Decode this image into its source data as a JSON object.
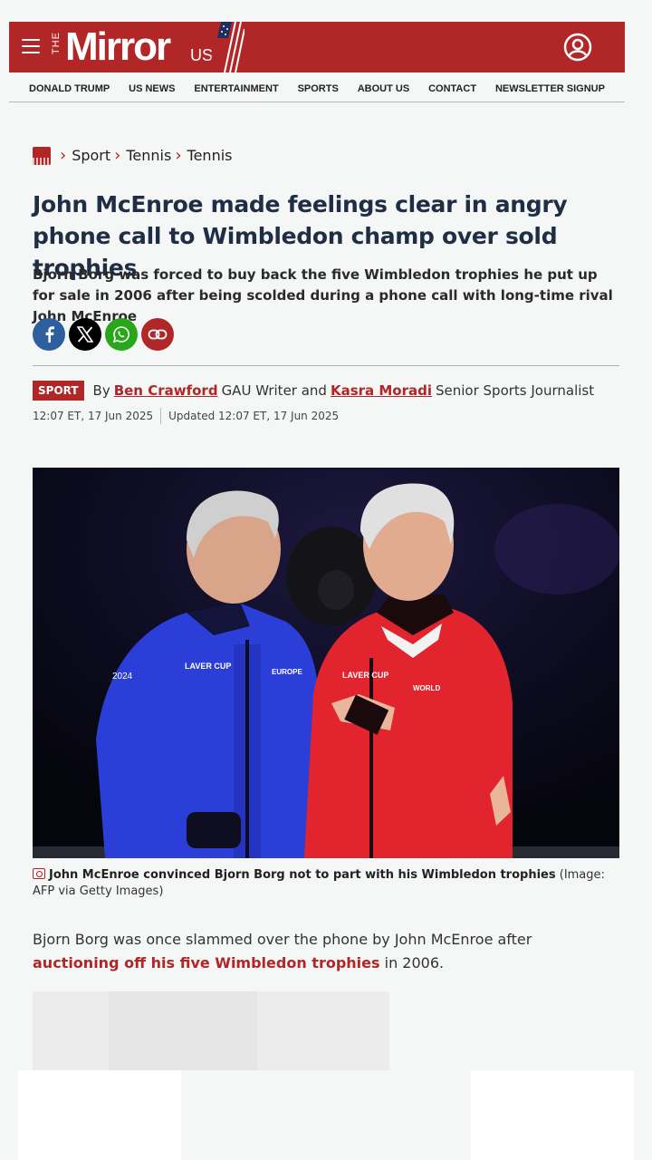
{
  "header": {
    "logo_the": "THE",
    "logo_main": "Mirror",
    "logo_us": "US",
    "brand_color": "#b12626"
  },
  "nav": [
    "DONALD TRUMP",
    "US NEWS",
    "ENTERTAINMENT",
    "SPORTS",
    "ABOUT US",
    "CONTACT",
    "NEWSLETTER SIGNUP"
  ],
  "breadcrumb": [
    "Sport",
    "Tennis",
    "Tennis"
  ],
  "article": {
    "title": "John McEnroe made feelings clear in angry phone call to Wimbledon champ over sold trophies",
    "standfirst": "Bjorn Borg was forced to buy back the five Wimbledon trophies he put up for sale in 2006 after being scolded during a phone call with long-time rival John McEnroe",
    "tag": "SPORT",
    "by": "By",
    "author1": "Ben Crawford",
    "author1_role": "GAU Writer and",
    "author2": "Kasra Moradi",
    "author2_role": "Senior Sports Journalist",
    "published": "12:07 ET, 17 Jun 2025",
    "updated": "Updated 12:07 ET, 17 Jun 2025",
    "caption_bold": "John McEnroe convinced Bjorn Borg not to part with his Wimbledon trophies",
    "caption_credit": " (Image: AFP via Getty Images)",
    "body_start": "Bjorn Borg was once slammed over the phone by John McEnroe after ",
    "body_link": "auctioning off his five Wimbledon trophies",
    "body_end": " in 2006.",
    "photo_texts": {
      "left_jacket_year": "2024",
      "left_jacket_logo": "LAVER CUP",
      "left_jacket_team": "EUROPE",
      "right_jacket_logo": "LAVER CUP",
      "right_jacket_team": "WORLD"
    }
  },
  "icons": [
    "hamburger-icon",
    "account-icon",
    "facebook-icon",
    "x-icon",
    "whatsapp-icon",
    "link-icon",
    "camera-icon"
  ]
}
